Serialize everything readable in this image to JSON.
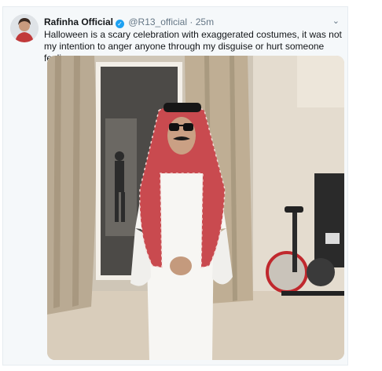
{
  "tweet": {
    "author_name": "Rafinha Official",
    "handle": "@R13_official",
    "separator": "·",
    "time": "25m",
    "verified_glyph": "✓",
    "caret_glyph": "⌄",
    "text": "Halloween is a scary celebration with exaggerated costumes, it was not my intention to anger anyone through my disguise or hurt someone feelings.",
    "avatar_icon": "profile-avatar",
    "verified_icon": "verified-badge-icon",
    "menu_icon": "chevron-down-icon",
    "colors": {
      "verified": "#1da1f2",
      "text": "#14171a",
      "muted": "#657786",
      "background": "#f5f8fa"
    }
  }
}
